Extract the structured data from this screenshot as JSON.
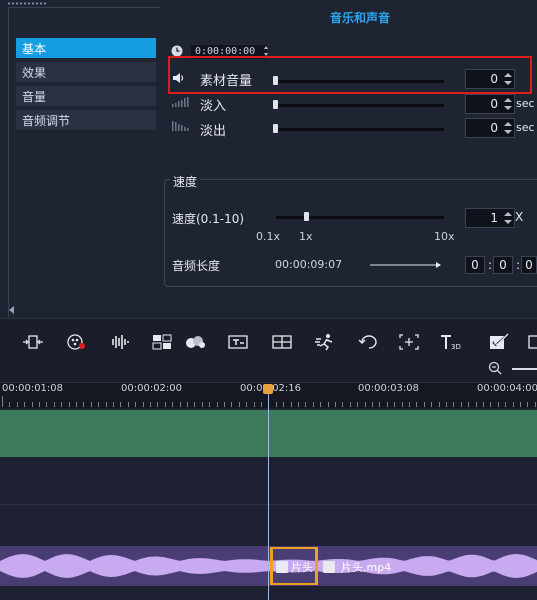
{
  "panel": {
    "section_title": "音乐和声音",
    "tabs": [
      {
        "label": "基本"
      },
      {
        "label": "效果"
      },
      {
        "label": "音量"
      },
      {
        "label": "音频调节"
      }
    ],
    "timecode": "0:00:00:00",
    "volume": {
      "label": "素材音量",
      "value": "0"
    },
    "fade_in": {
      "label": "淡入",
      "value": "0",
      "unit": "sec"
    },
    "fade_out": {
      "label": "淡出",
      "value": "0",
      "unit": "sec"
    },
    "speed": {
      "group_title": "速度",
      "label": "速度(0.1-10)",
      "value": "1",
      "unit": "X",
      "scale_min": "0.1x",
      "scale_mid": "1x",
      "scale_max": "10x",
      "duration_label": "音频长度",
      "duration_value": "00:00:09:07",
      "time_fields": [
        "0",
        "0",
        "0"
      ]
    }
  },
  "toolbar": {
    "icons": [
      "fit-clip-icon",
      "mix-effect-icon",
      "audio-waveform-icon",
      "multicam-icon",
      "blend-icon",
      "title-icon",
      "split-screen-icon",
      "motion-tracking-icon",
      "rotate-icon",
      "freeze-icon",
      "3d-title-icon",
      "checklist-icon",
      "subtitle-icon"
    ]
  },
  "timeline": {
    "ruler": [
      "00:00:01:08",
      "00:00:02:00",
      "00:00:02:16",
      "00:00:03:08",
      "00:00:04:00"
    ],
    "clips": [
      {
        "label": "片头"
      },
      {
        "label": "片头.mp4"
      }
    ]
  },
  "colors": {
    "accent": "#159de0",
    "highlight": "#e01b1b",
    "video_track": "#3b7a5b",
    "audio_track": "#4a3d74",
    "waveform": "#c8aaf0",
    "selection": "#f0a020"
  }
}
